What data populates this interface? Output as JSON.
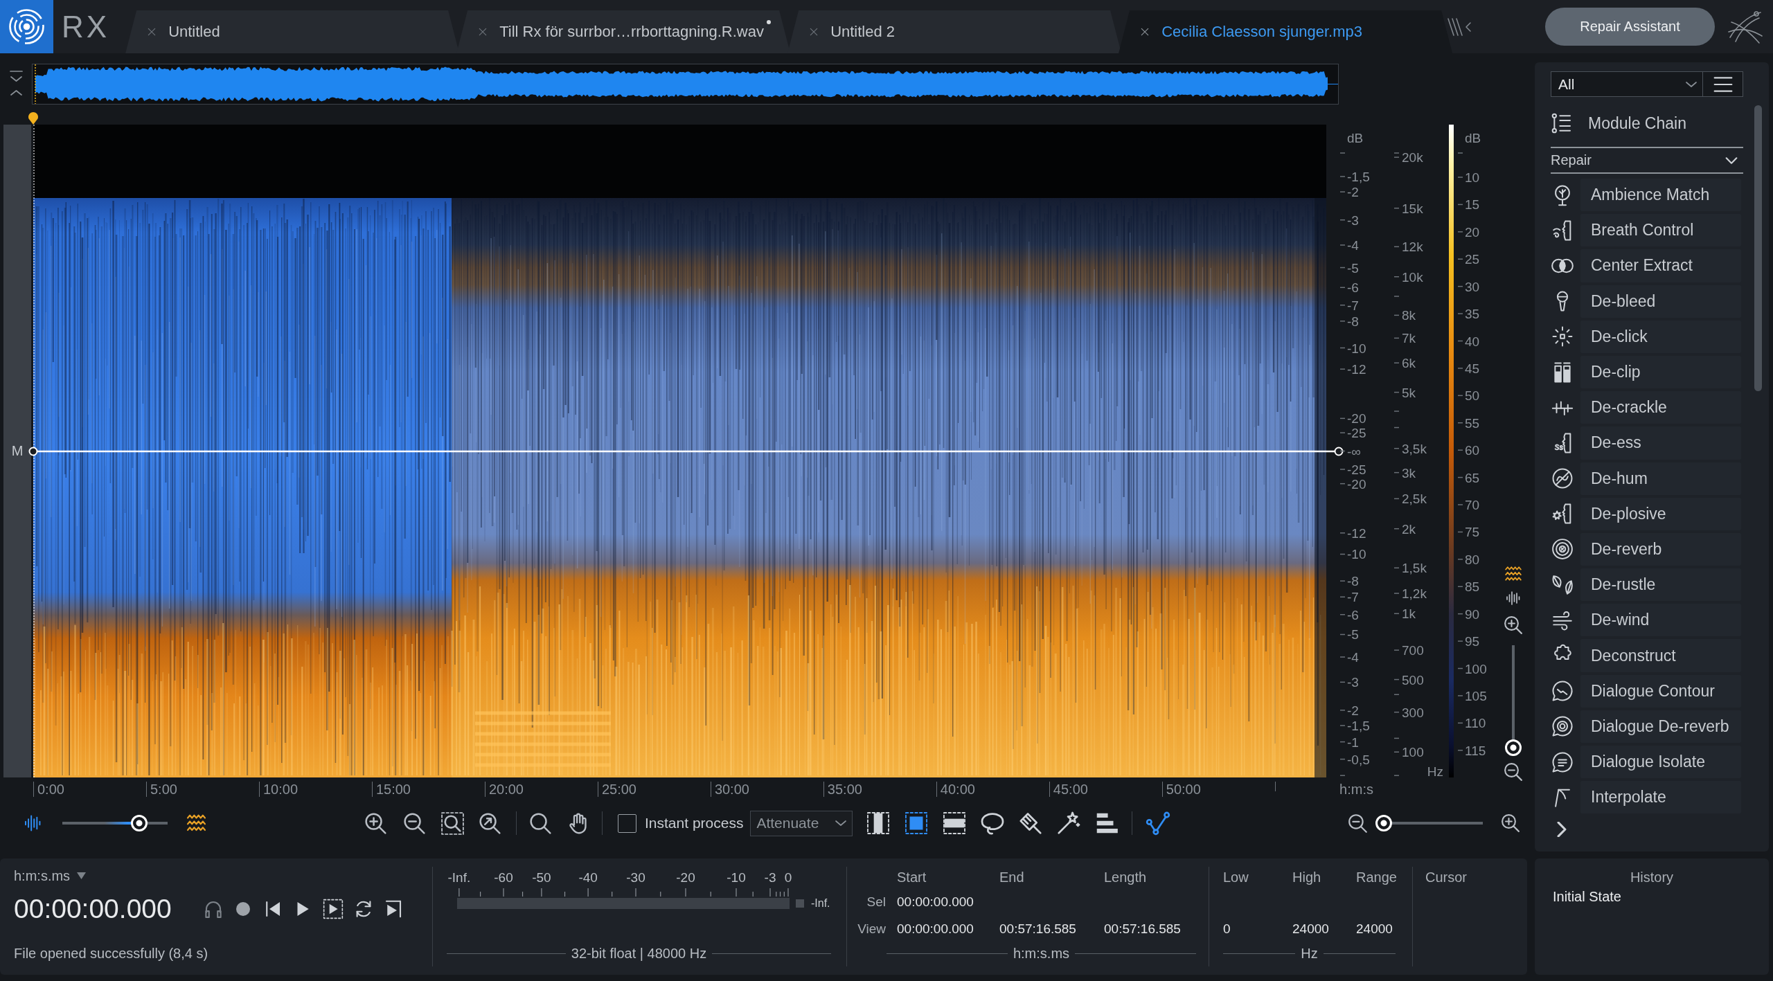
{
  "app": {
    "logo_text": "RX"
  },
  "tabs": [
    {
      "label": "Untitled",
      "selected": false,
      "modified": false
    },
    {
      "label": "Till Rx för surrbor…rrborttagning.R.wav",
      "selected": false,
      "modified": true
    },
    {
      "label": "Untitled 2",
      "selected": false,
      "modified": false
    },
    {
      "label": "Cecilia Claesson sjunger.mp3",
      "selected": true,
      "modified": false
    }
  ],
  "repair_assistant_button": {
    "label": "Repair Assistant"
  },
  "editor": {
    "channel_label": "M",
    "amplitude_scale": {
      "unit": "dB",
      "labels": [
        "-1,5",
        "-2",
        "-3",
        "-4",
        "-5",
        "-6",
        "-7",
        "-8",
        "-10",
        "-12",
        "-20",
        "-25",
        "-∞",
        "-25",
        "-20",
        "-12",
        "-10",
        "-8",
        "-7",
        "-6",
        "-5",
        "-4",
        "-3",
        "-2",
        "-1,5",
        "-1",
        "-0,5"
      ]
    },
    "frequency_scale": {
      "unit": "Hz",
      "labels": [
        "20k",
        "15k",
        "12k",
        "10k",
        "8k",
        "7k",
        "6k",
        "5k",
        "3,5k",
        "3k",
        "2,5k",
        "2k",
        "1,5k",
        "1,2k",
        "1k",
        "700",
        "500",
        "300",
        "100"
      ]
    },
    "color_scale": {
      "unit": "dB",
      "labels": [
        "10",
        "15",
        "20",
        "25",
        "30",
        "35",
        "40",
        "45",
        "50",
        "55",
        "60",
        "65",
        "70",
        "75",
        "80",
        "85",
        "90",
        "95",
        "100",
        "105",
        "110",
        "115"
      ]
    },
    "time_axis": {
      "labels": [
        "0:00",
        "5:00",
        "10:00",
        "15:00",
        "20:00",
        "25:00",
        "30:00",
        "35:00",
        "40:00",
        "45:00",
        "50:00"
      ],
      "unit": "h:m:s"
    },
    "vertical_zoom": {
      "level": 0
    }
  },
  "toolbar": {
    "display_blend": {
      "level": 0.73
    },
    "instant_process": {
      "label": "Instant process",
      "checked": false
    },
    "process_mode": {
      "value": "Attenuate"
    },
    "selection_tools": [
      {
        "kind": "time",
        "selected": false
      },
      {
        "kind": "time_frequency",
        "selected": true
      },
      {
        "kind": "frequency",
        "selected": false
      },
      {
        "kind": "lasso",
        "selected": false
      },
      {
        "kind": "brush",
        "selected": false
      },
      {
        "kind": "wand",
        "selected": false
      },
      {
        "kind": "harmonic",
        "selected": false
      }
    ],
    "point_tool": {
      "on": true
    },
    "horizontal_zoom": {
      "level": 0
    }
  },
  "transport": {
    "time_format": "h:m:s.ms",
    "time": "00:00:00.000",
    "status": "File opened successfully (8,4 s)"
  },
  "meter": {
    "labels": [
      "-Inf.",
      "-60",
      "-50",
      "-40",
      "-30",
      "-20",
      "-10",
      "-3",
      "0"
    ],
    "peak": "-Inf.",
    "format": "32-bit float | 48000 Hz"
  },
  "selection": {
    "columns": [
      "Start",
      "End",
      "Length"
    ],
    "rows": [
      {
        "label": "Sel",
        "values": [
          "00:00:00.000"
        ]
      },
      {
        "label": "View",
        "values": [
          "00:00:00.000",
          "00:57:16.585",
          "00:57:16.585"
        ]
      }
    ],
    "unit": "h:m:s.ms"
  },
  "frequency_range": {
    "columns": [
      "Low",
      "High",
      "Range"
    ],
    "values": [
      "0",
      "24000",
      "24000"
    ],
    "unit": "Hz"
  },
  "cursor": {
    "label": "Cursor"
  },
  "module_panel": {
    "filter": "All",
    "module_chain": "Module Chain",
    "category": {
      "label": "Repair",
      "expanded": true
    },
    "modules": [
      {
        "label": "Ambience Match",
        "kind": "ambience"
      },
      {
        "label": "Breath Control",
        "kind": "breath"
      },
      {
        "label": "Center Extract",
        "kind": "center"
      },
      {
        "label": "De-bleed",
        "kind": "bleed"
      },
      {
        "label": "De-click",
        "kind": "click"
      },
      {
        "label": "De-clip",
        "kind": "clip"
      },
      {
        "label": "De-crackle",
        "kind": "crackle"
      },
      {
        "label": "De-ess",
        "kind": "ess"
      },
      {
        "label": "De-hum",
        "kind": "hum"
      },
      {
        "label": "De-plosive",
        "kind": "plosive"
      },
      {
        "label": "De-reverb",
        "kind": "reverb"
      },
      {
        "label": "De-rustle",
        "kind": "rustle"
      },
      {
        "label": "De-wind",
        "kind": "wind"
      },
      {
        "label": "Deconstruct",
        "kind": "deconstruct"
      },
      {
        "label": "Dialogue Contour",
        "kind": "contour"
      },
      {
        "label": "Dialogue De-reverb",
        "kind": "dialoguereverb"
      },
      {
        "label": "Dialogue Isolate",
        "kind": "isolate"
      },
      {
        "label": "Interpolate",
        "kind": "interpolate"
      }
    ]
  },
  "history": {
    "title": "History",
    "items": [
      {
        "label": "Initial State"
      }
    ]
  }
}
